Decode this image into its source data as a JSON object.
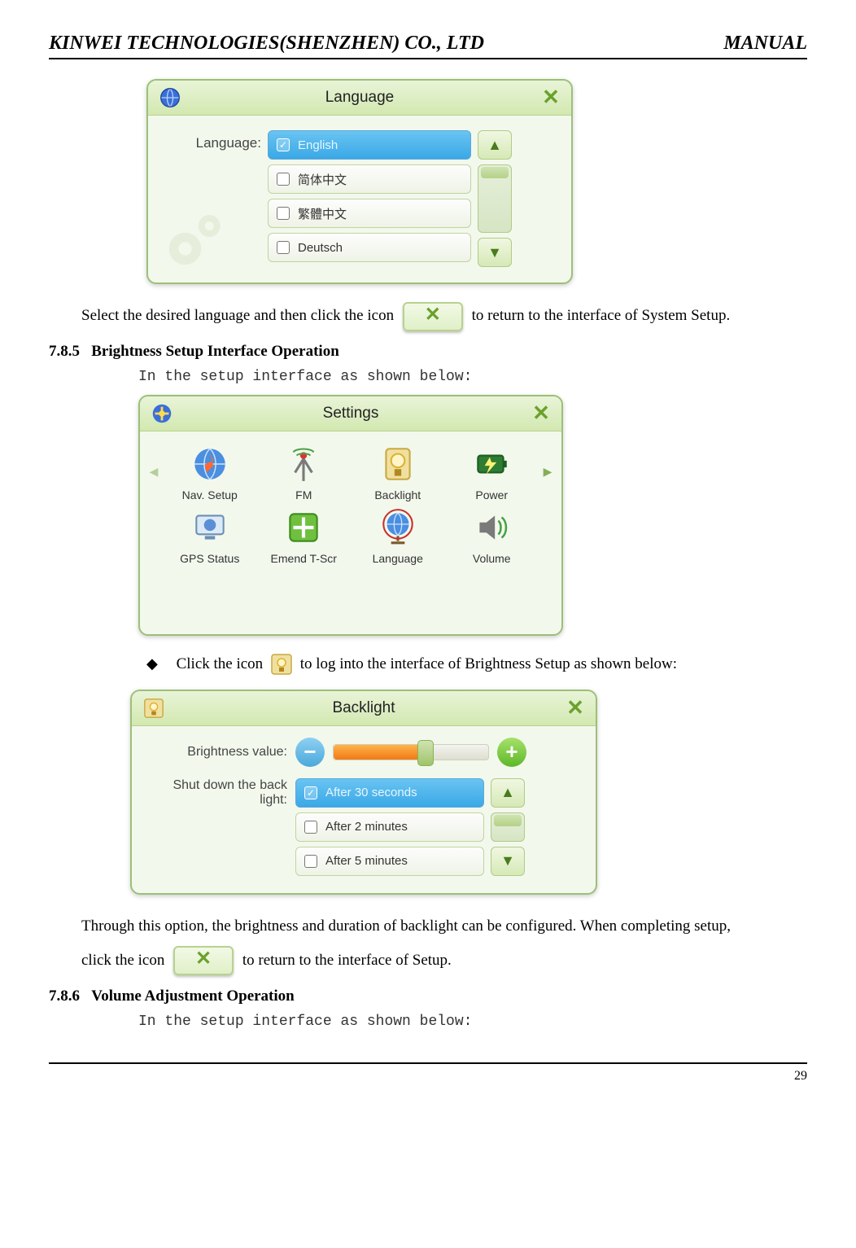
{
  "header": {
    "company": "KINWEI TECHNOLOGIES(SHENZHEN) CO., LTD",
    "doc_type": "MANUAL"
  },
  "footer": {
    "page": "29"
  },
  "language_window": {
    "title": "Language",
    "label": "Language:",
    "options": [
      "English",
      "简体中文",
      "繁體中文",
      "Deutsch"
    ],
    "selected_index": 0
  },
  "text": {
    "para1a": "Select the desired language and then click the icon",
    "para1b": "to return to the interface of System Setup.",
    "sec785_num": "7.8.5",
    "sec785_title": "Brightness Setup Interface Operation",
    "mono1": "In the setup interface as shown below:",
    "bullet1a": "Click the icon",
    "bullet1b": "to log into the interface of Brightness Setup as shown below:",
    "para2a": "Through this option, the brightness and duration of backlight can be configured. When completing setup,",
    "para2b": "click the icon",
    "para2c": "to return to the interface of Setup.",
    "sec786_num": "7.8.6",
    "sec786_title": "Volume Adjustment Operation",
    "mono2": "In the setup interface as shown below:"
  },
  "settings_window": {
    "title": "Settings",
    "items": [
      "Nav. Setup",
      "FM",
      "Backlight",
      "Power",
      "GPS Status",
      "Emend T-Scr",
      "Language",
      "Volume"
    ]
  },
  "backlight_window": {
    "title": "Backlight",
    "brightness_label": "Brightness value:",
    "shutdown_label1": "Shut down the back",
    "shutdown_label2": "light:",
    "options": [
      "After 30 seconds",
      "After 2 minutes",
      "After 5 minutes"
    ],
    "selected_index": 0
  }
}
